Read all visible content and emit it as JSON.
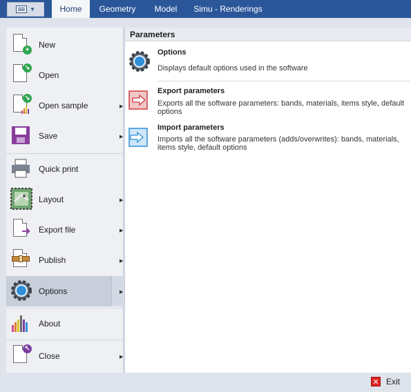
{
  "ribbon": {
    "tabs": [
      {
        "label": "Home"
      },
      {
        "label": "Geometry"
      },
      {
        "label": "Model"
      },
      {
        "label": "Simu - Renderings"
      }
    ]
  },
  "menu": {
    "items": [
      {
        "label": "New",
        "icon": "new-file-icon"
      },
      {
        "label": "Open",
        "icon": "open-file-icon"
      },
      {
        "label": "Open sample",
        "icon": "open-sample-icon"
      },
      {
        "label": "Save",
        "icon": "save-icon"
      },
      {
        "label": "Quick print",
        "icon": "printer-icon"
      },
      {
        "label": "Layout",
        "icon": "layout-icon"
      },
      {
        "label": "Export file",
        "icon": "export-file-icon"
      },
      {
        "label": "Publish",
        "icon": "publish-icon"
      },
      {
        "label": "Options",
        "icon": "options-gear-icon"
      },
      {
        "label": "About",
        "icon": "about-icon"
      },
      {
        "label": "Close",
        "icon": "close-file-icon"
      }
    ]
  },
  "parameters": {
    "header": "Parameters",
    "items": [
      {
        "title": "Options",
        "description": "Displays default options used in the software",
        "icon": "gear-icon"
      },
      {
        "title": "Export parameters",
        "description": "Exports all the software parameters: bands, materials, items style, default options",
        "icon": "export-arrow-icon"
      },
      {
        "title": "Import parameters",
        "description": "Imports all the software parameters (adds/overwrites): bands, materials, items style, default options",
        "icon": "import-arrow-icon"
      }
    ]
  },
  "footer": {
    "exit_label": "Exit"
  },
  "colors": {
    "accent": "#2b579a",
    "selected": "#c8cfdb",
    "export": "#d9534f",
    "import": "#2e8fd8"
  }
}
